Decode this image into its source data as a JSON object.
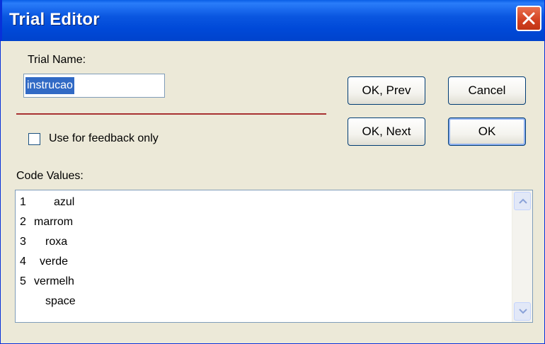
{
  "window": {
    "title": "Trial Editor"
  },
  "form": {
    "trial_name_label": "Trial Name:",
    "trial_name_value": "instrucao",
    "feedback_checkbox_label": "Use for feedback only",
    "feedback_checked": false,
    "code_values_label": "Code Values:"
  },
  "buttons": {
    "ok_prev": "OK, Prev",
    "cancel": "Cancel",
    "ok_next": "OK, Next",
    "ok": "OK"
  },
  "code_values": [
    {
      "num": "1",
      "value": "azul"
    },
    {
      "num": "2",
      "value": "marrom"
    },
    {
      "num": "3",
      "value": "roxa"
    },
    {
      "num": "4",
      "value": "verde"
    },
    {
      "num": "5",
      "value": "vermelh"
    },
    {
      "num": "",
      "value": "space"
    }
  ],
  "icons": {
    "close": "close-icon",
    "scroll_up": "scroll-up-arrow-icon",
    "scroll_down": "scroll-down-arrow-icon"
  },
  "colors": {
    "title_bar": "#0a56e0",
    "close_button": "#d24020",
    "selection": "#316ac5",
    "divider": "#a83232"
  }
}
